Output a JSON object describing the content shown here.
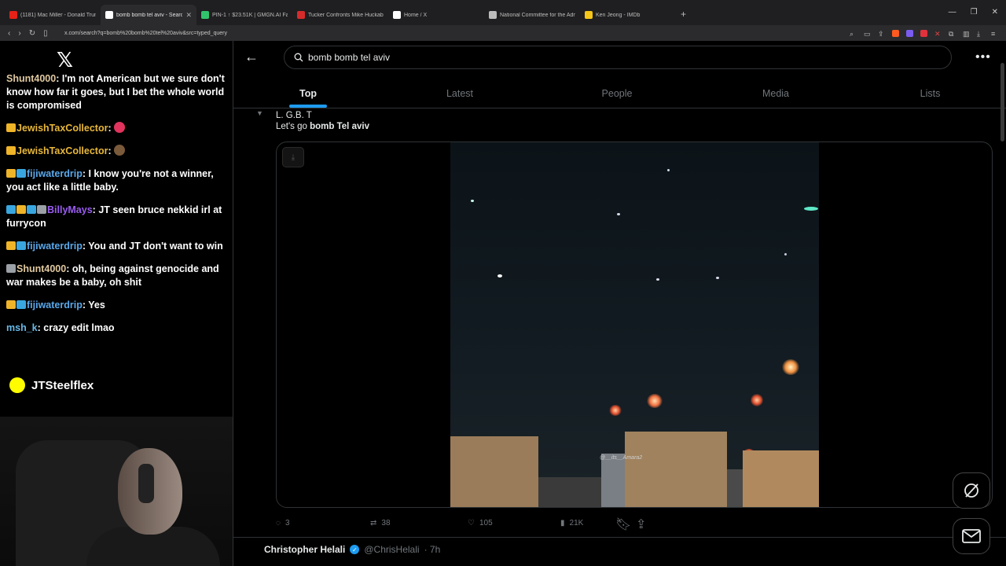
{
  "browser": {
    "tabs": [
      {
        "title": "(1181) Mac Miller - Donald Trump - Y",
        "fav_color": "#e62117"
      },
      {
        "title": "bomb bomb tel aviv - Search",
        "fav_color": "#ffffff",
        "active": true
      },
      {
        "title": "PIN-1 ↑ $23.51K | GMGN.AI Fast Trad",
        "fav_color": "#31c46d"
      },
      {
        "title": "Tucker Confronts Mike Huckabee on",
        "fav_color": "#d62b2b"
      },
      {
        "title": "Home / X",
        "fav_color": "#ffffff"
      },
      {
        "title": "National Committee for the Adminis",
        "fav_color": "#bbbbbb"
      },
      {
        "title": "Ken Jeong - IMDb",
        "fav_color": "#f5c518"
      }
    ],
    "new_tab": "+",
    "url": "x.com/search?q=bomb%20bomb%20tel%20aviv&src=typed_query"
  },
  "chat": {
    "messages": [
      {
        "user": "Shunt4000",
        "text": "I'm not American but we sure don't know how far it goes, but I bet the whole world is compromised",
        "user_class": "user-tan"
      },
      {
        "user": "JewishTaxCollector",
        "text": "",
        "user_class": "user-gold"
      },
      {
        "user": "JewishTaxCollector",
        "text": "",
        "user_class": "user-gold"
      },
      {
        "user": "fijiwaterdrip",
        "text": "I know you're not a winner, you act like a little baby.",
        "user_class": "user-blue"
      },
      {
        "user": "BillyMays",
        "text": "JT seen bruce nekkid irl at furrycon",
        "user_class": "user-purple"
      },
      {
        "user": "fijiwaterdrip",
        "text": "You and JT don't want to win",
        "user_class": "user-blue"
      },
      {
        "user": "Shunt4000",
        "text": "oh, being against genocide and war makes be a baby, oh shit",
        "user_class": "user-tan"
      },
      {
        "user": "fijiwaterdrip",
        "text": "Yes",
        "user_class": "user-blue"
      },
      {
        "user": "msh_k",
        "text": "crazy edit lmao",
        "user_class": "user-teal"
      }
    ],
    "snapchat_handle": "JTSteelflex"
  },
  "search": {
    "query": "bomb bomb tel aviv",
    "tabs": [
      "Top",
      "Latest",
      "People",
      "Media",
      "Lists"
    ],
    "active_tab": "Top"
  },
  "tweet": {
    "line1": "L. G.B. T",
    "line2_prefix": "Let's go ",
    "line2_bold": "bomb Tel aviv",
    "watermark": "@__its__Amara2",
    "replies": "3",
    "reposts": "38",
    "likes": "105",
    "views": "21K"
  },
  "next_tweet": {
    "name": "Christopher Helali",
    "handle": "@ChrisHelali",
    "time": "· 7h"
  },
  "colors": {
    "accent": "#1d9bf0",
    "background": "#000000",
    "muted": "#71767b"
  }
}
